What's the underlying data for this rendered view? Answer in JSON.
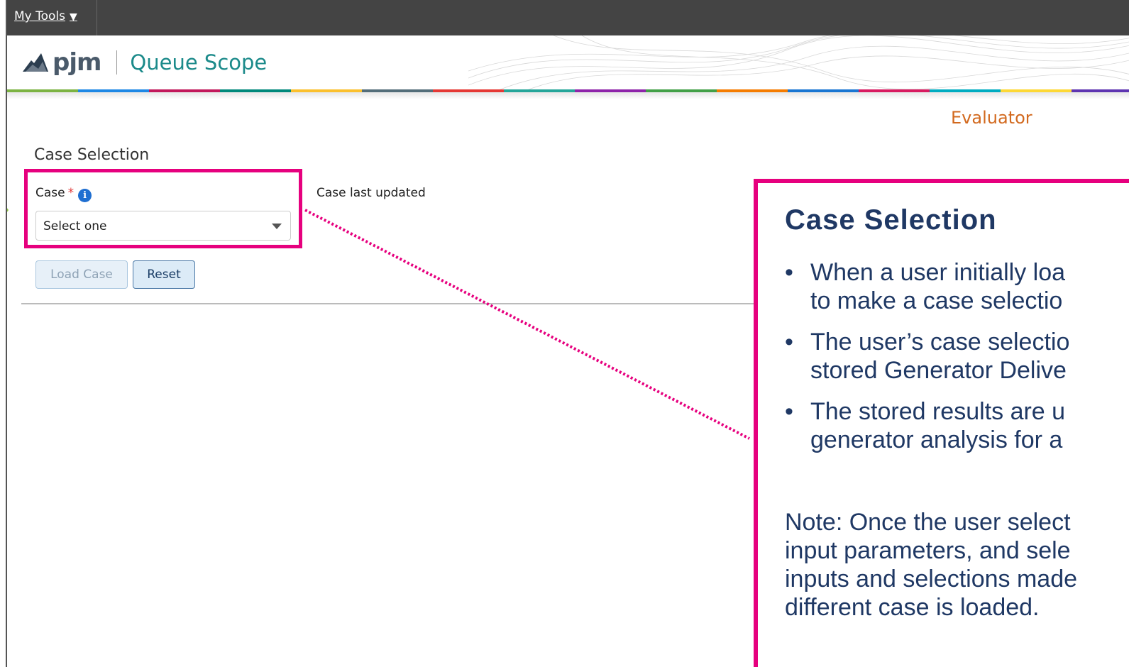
{
  "topbar": {
    "my_tools": "My Tools",
    "my_tools_arrow": "▼"
  },
  "header": {
    "logo_text": "pjm",
    "app_title": "Queue Scope"
  },
  "role": "Evaluator",
  "case_selection": {
    "section_title": "Case Selection",
    "case_label": "Case",
    "required_mark": "*",
    "info_icon": "i",
    "case_last_updated": "Case last updated",
    "select_value": "Select one",
    "load_case_button": "Load Case",
    "reset_button": "Reset"
  },
  "callout": {
    "title": "Case Selection",
    "bullets": [
      [
        "When a user initially loa",
        "to make a case selectio"
      ],
      [
        "The user’s case selectio",
        "stored Generator Delive"
      ],
      [
        "The stored results are u",
        "generator analysis for a"
      ]
    ],
    "note_lines": [
      "Note: Once the user select",
      "input parameters, and sele",
      "inputs and selections made",
      "different case is loaded."
    ]
  },
  "colors": {
    "highlight": "#e6007e",
    "accent_arrow": "#8dc63f",
    "callout_text": "#1f3864",
    "app_title": "#1b8a8a",
    "evaluator": "#d2691e",
    "color_bar": [
      "#7cb342",
      "#1e88e5",
      "#c2185b",
      "#00897b",
      "#fbc02d",
      "#546e7a",
      "#e53935",
      "#26a69a",
      "#8e24aa",
      "#43a047",
      "#f57c00",
      "#1976d2",
      "#d81b60",
      "#00acc1",
      "#fdd835",
      "#5e35b1"
    ]
  },
  "icons": {
    "info": "info-icon",
    "dropdown": "chevron-down-icon",
    "logo": "pjm-logo-icon"
  }
}
